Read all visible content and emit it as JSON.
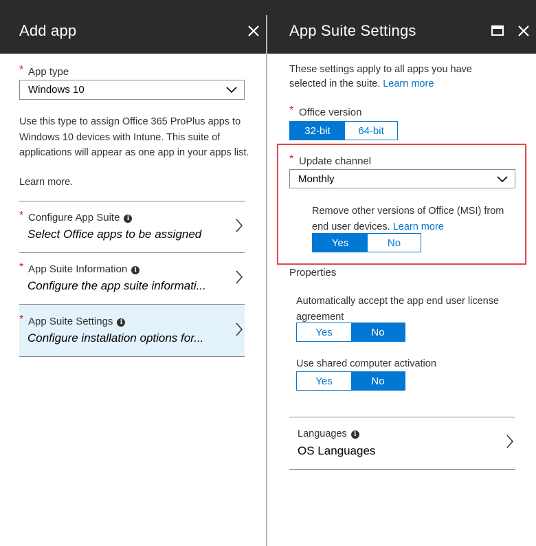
{
  "left_panel": {
    "title": "Add app",
    "app_type": {
      "label": "App type",
      "value": "Windows 10"
    },
    "description": "Use this type to assign Office 365 ProPlus apps to Windows 10 devices with Intune. This suite of applications will appear as one app in your apps list.",
    "learn_more": "Learn more.",
    "items": [
      {
        "title": "Configure App Suite",
        "subtitle": "Select Office apps to be assigned"
      },
      {
        "title": "App Suite Information",
        "subtitle": "Configure the app suite informati..."
      },
      {
        "title": "App Suite Settings",
        "subtitle": "Configure installation options for..."
      }
    ]
  },
  "right_panel": {
    "title": "App Suite Settings",
    "intro": "These settings apply to all apps you have selected in the suite.",
    "intro_link": "Learn more",
    "office_version": {
      "label": "Office version",
      "options": [
        "32-bit",
        "64-bit"
      ],
      "selected": "32-bit"
    },
    "update_channel": {
      "label": "Update channel",
      "value": "Monthly"
    },
    "remove_msi": {
      "text": "Remove other versions of Office (MSI) from end user devices.",
      "link": "Learn more",
      "options": [
        "Yes",
        "No"
      ],
      "selected": "Yes"
    },
    "properties_heading": "Properties",
    "eula": {
      "text": "Automatically accept the app end user license agreement",
      "options": [
        "Yes",
        "No"
      ],
      "selected": "No"
    },
    "shared_activation": {
      "text": "Use shared computer activation",
      "options": [
        "Yes",
        "No"
      ],
      "selected": "No"
    },
    "languages": {
      "title": "Languages",
      "value": "OS Languages"
    }
  },
  "colors": {
    "header_bg": "#2b2b2b",
    "accent": "#0078d4",
    "link": "#0072c6",
    "required": "#e81123",
    "selected_row": "#e3f2fb",
    "annotation": "#e24b4f"
  },
  "icons": [
    "close-icon",
    "maximize-icon",
    "chevron-down-icon",
    "chevron-right-icon",
    "info-icon"
  ]
}
